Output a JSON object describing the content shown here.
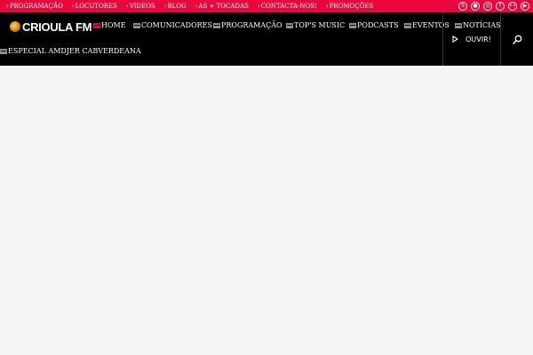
{
  "topbar": {
    "links": [
      "PROGRAMAÇÃO",
      "LOCUTORES",
      "VIDEOS",
      "BLOG",
      "AS + TOCADAS",
      "CONTACTA-NOS!",
      "PROMOÇÕES"
    ],
    "chevron": "›",
    "socials": [
      {
        "icon": "skype-icon",
        "glyph": "S"
      },
      {
        "icon": "myspace-icon",
        "glyph": "●"
      },
      {
        "icon": "instagram-icon",
        "glyph": "◎"
      },
      {
        "icon": "facebook-icon",
        "glyph": "f"
      },
      {
        "icon": "flickr-icon",
        "glyph": "••"
      },
      {
        "icon": "youtube-icon",
        "glyph": "▶"
      }
    ]
  },
  "brand": {
    "name": "CRIOULA FM",
    "colors": {
      "accent": "#e8063c",
      "nav_bg": "#000000",
      "page_bg": "#f4f4f4"
    }
  },
  "nav": {
    "items": [
      {
        "label": "HOME",
        "active": true
      },
      {
        "label": "COMUNICADORES",
        "active": false
      },
      {
        "label": "PROGRAMAÇÃO",
        "active": false
      },
      {
        "label": "TOP'S MUSIC",
        "active": false
      },
      {
        "label": "PODCASTS",
        "active": false
      },
      {
        "label": "EVENTOS",
        "active": false
      },
      {
        "label": "NOTÍCIAS",
        "active": false
      },
      {
        "label": "ESPECIAL AMDJER CABVERDEANA",
        "active": false
      }
    ],
    "listen_label": "OUVIR!"
  }
}
